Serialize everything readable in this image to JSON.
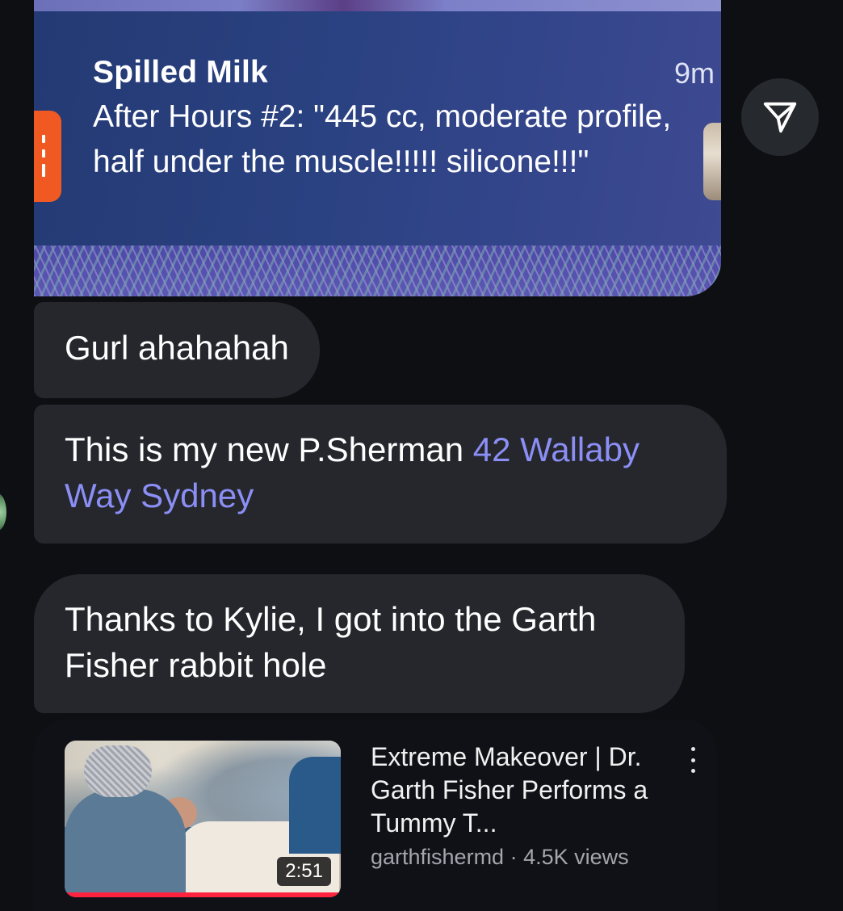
{
  "shared_notification": {
    "app_name": "Spilled Milk",
    "time": "9m",
    "body": "After Hours #2: \"445 cc, moderate profile, half under the muscle!!!!! silicone!!!\""
  },
  "messages": [
    {
      "text": "Gurl ahahahah"
    },
    {
      "text_before": "This is my new P.Sherman ",
      "link": "42 Wallaby Way Sydney"
    },
    {
      "text": "Thanks to Kylie, I got into the Garth Fisher rabbit hole"
    }
  ],
  "video": {
    "title": "Extreme Makeover | Dr. Garth Fisher Performs a Tummy T...",
    "channel": "garthfishermd",
    "separator": " · ",
    "views": "4.5K views",
    "duration": "2:51",
    "progress_fraction": 1.0
  },
  "icons": {
    "share": "send-icon",
    "more": "more-vertical-icon"
  },
  "colors": {
    "background": "#0d0f12",
    "bubble": "#25272d",
    "link": "#8b8ff5",
    "progress": "#ff2340"
  }
}
